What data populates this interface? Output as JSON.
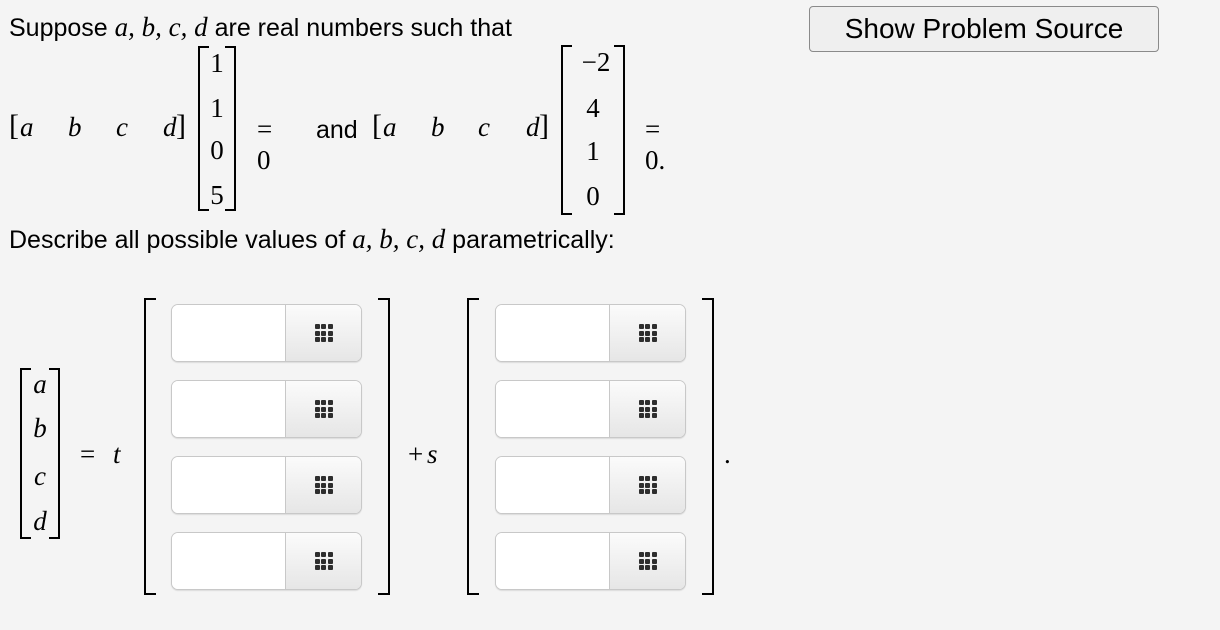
{
  "problem": {
    "intro_prefix": "Suppose",
    "intro_vars": "a, b, c, d",
    "intro_suffix": "are real numbers such that",
    "row_vector": [
      "a",
      "b",
      "c",
      "d"
    ],
    "equation1": {
      "column": [
        "1",
        "1",
        "0",
        "5"
      ],
      "rhs": "= 0"
    },
    "connector": "and",
    "equation2": {
      "column": [
        "−2",
        "4",
        "1",
        "0"
      ],
      "rhs": "= 0."
    },
    "describe_prefix": "Describe all possible values of",
    "describe_vars": "a, b, c, d",
    "describe_suffix": "parametrically:"
  },
  "answer": {
    "lhs_vector": [
      "a",
      "b",
      "c",
      "d"
    ],
    "equals": "=",
    "param1": "t",
    "plus": "+",
    "param2": "s",
    "end_punct": ".",
    "vector_t": [
      {
        "value": "",
        "placeholder": ""
      },
      {
        "value": "",
        "placeholder": ""
      },
      {
        "value": "",
        "placeholder": ""
      },
      {
        "value": "",
        "placeholder": ""
      }
    ],
    "vector_s": [
      {
        "value": "",
        "placeholder": ""
      },
      {
        "value": "",
        "placeholder": ""
      },
      {
        "value": "",
        "placeholder": ""
      },
      {
        "value": "",
        "placeholder": ""
      }
    ],
    "input_button_icon": "grid-icon"
  },
  "toolbar": {
    "show_source_label": "Show Problem Source"
  }
}
